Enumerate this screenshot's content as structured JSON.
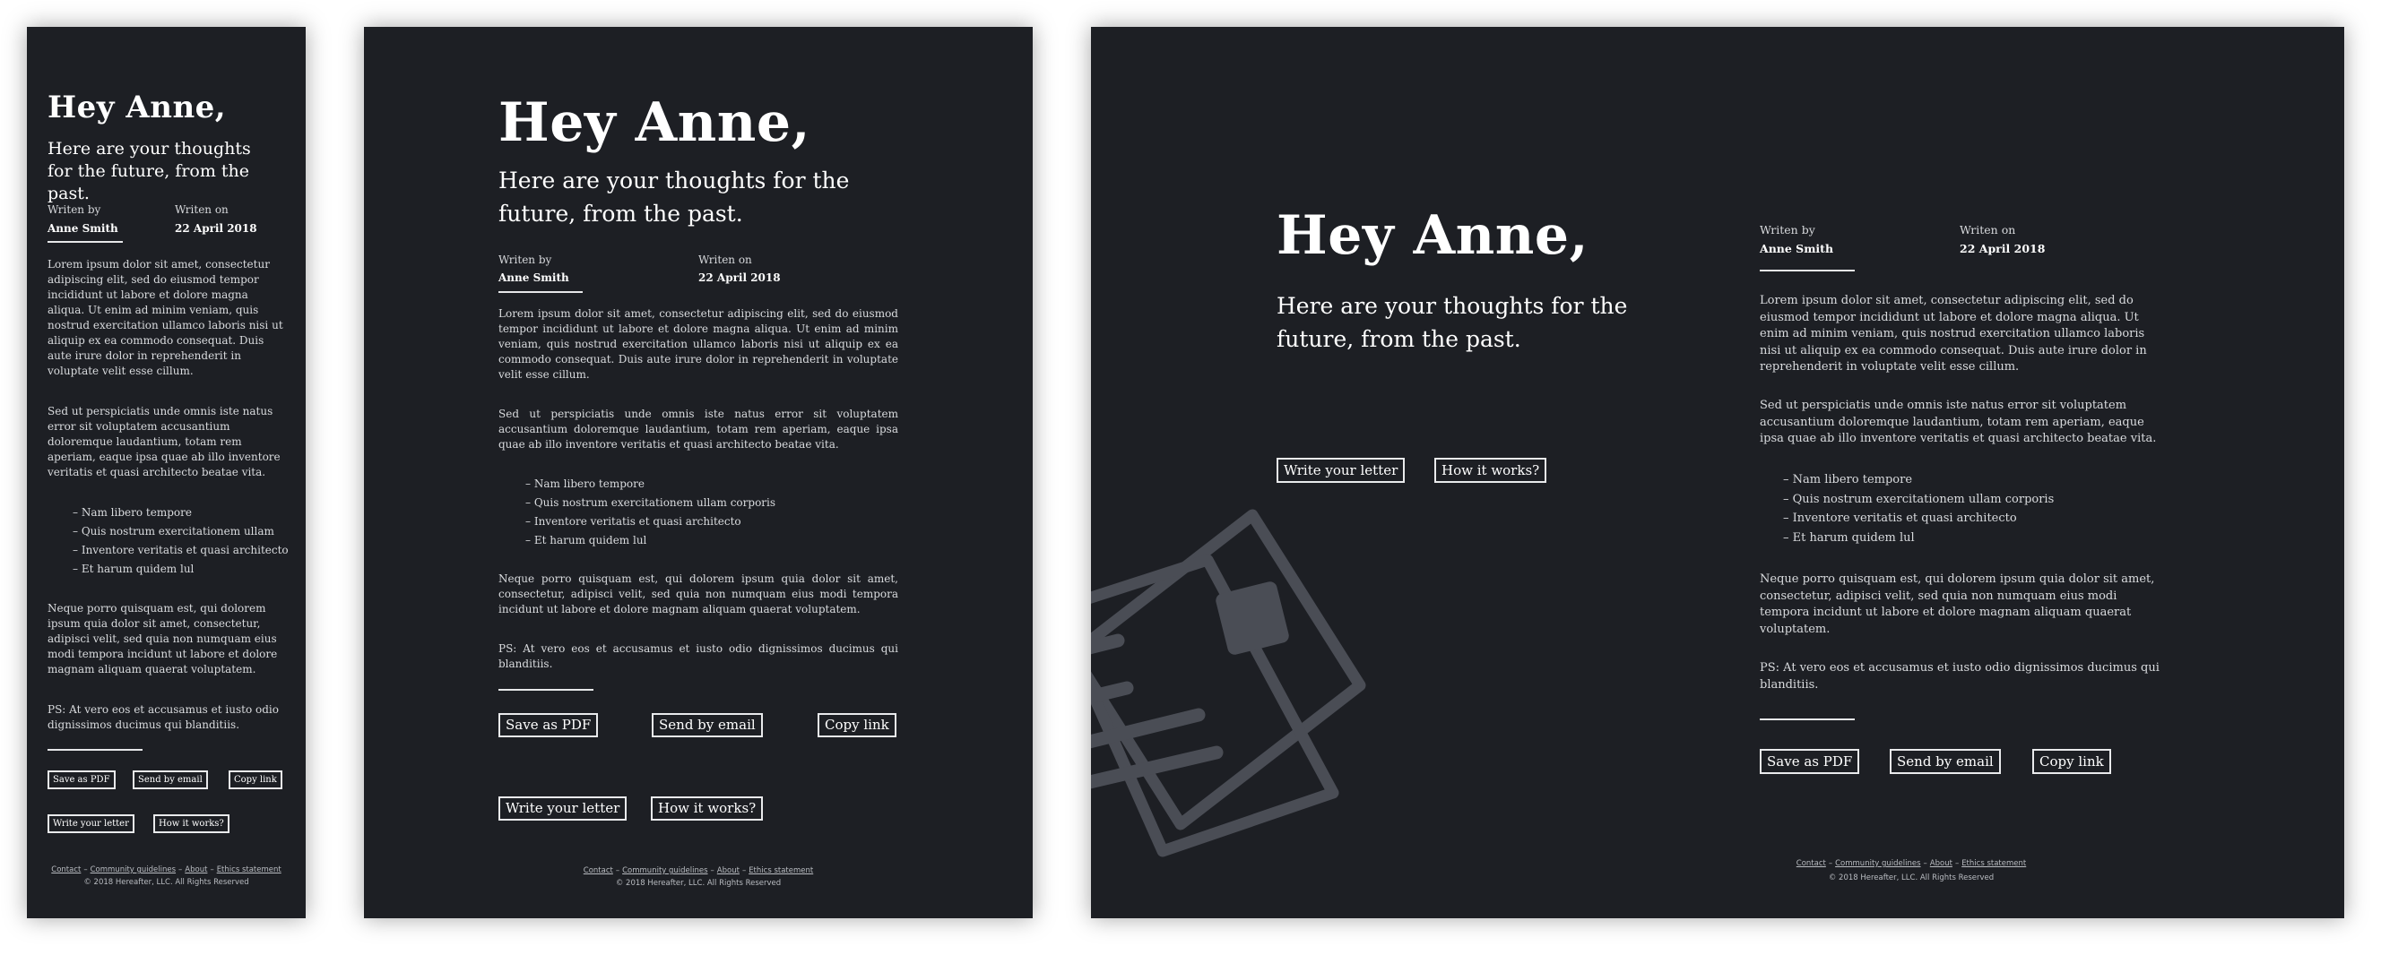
{
  "greeting": "Hey Anne,",
  "subtitle": "Here are your thoughts for the future, from the past.",
  "meta": {
    "written_by_label": "Writen by",
    "author": "Anne Smith",
    "written_on_label": "Writen on",
    "date": "22 April 2018"
  },
  "letter": {
    "para1": "Lorem ipsum dolor sit amet, consectetur adipiscing elit, sed do eiusmod tempor incididunt ut labore et dolore magna aliqua. Ut enim ad minim veniam, quis nostrud exercitation ullamco laboris nisi ut aliquip ex ea commodo consequat. Duis aute irure dolor in reprehenderit in voluptate velit esse cillum.",
    "para2": "Sed ut perspiciatis unde omnis iste natus error sit voluptatem accusantium doloremque laudantium, totam rem aperiam, eaque ipsa quae ab illo inventore veritatis et quasi architecto beatae vita.",
    "list": [
      "Nam libero tempore",
      "Quis nostrum exercitationem ullam corporis",
      "Inventore veritatis et quasi architecto",
      "Et harum quidem lul"
    ],
    "list_mobile": [
      "Nam libero tempore",
      "Quis nostrum exercitationem ullam",
      "Inventore veritatis et quasi architecto",
      "Et harum quidem lul"
    ],
    "para3": "Neque porro quisquam est, qui dolorem ipsum quia dolor sit amet, consectetur, adipisci velit, sed quia non numquam eius modi tempora incidunt ut labore et dolore magnam aliquam quaerat voluptatem.",
    "ps": "PS: At vero eos et accusamus et iusto odio dignissimos ducimus qui blanditiis."
  },
  "actions": {
    "save_pdf": "Save as PDF",
    "send_email": "Send by email",
    "copy_link": "Copy link",
    "write_letter": "Write your letter",
    "how_it_works": "How it works?"
  },
  "footer": {
    "contact": "Contact",
    "guidelines": "Community guidelines",
    "about": "About",
    "ethics": "Ethics statement",
    "separator": "–",
    "copyright": "© 2018 Hereafter, LLC. All Rights Reserved"
  },
  "colors": {
    "background": "#1d1f24",
    "text": "#ffffff",
    "illustration": "#4a4d55"
  },
  "icons": {
    "hero": "envelope-icon"
  }
}
